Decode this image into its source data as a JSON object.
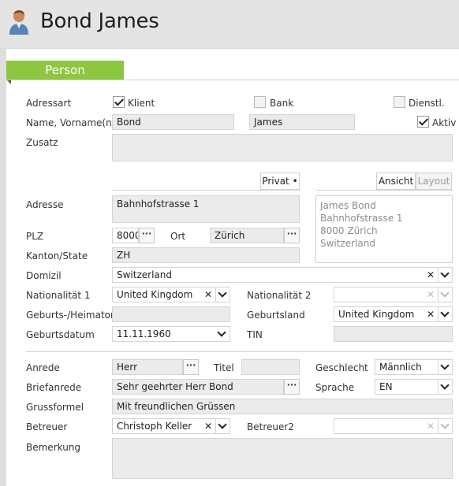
{
  "header": {
    "title": "Bond James",
    "icon": "person-icon"
  },
  "section": {
    "title": "Person"
  },
  "labels": {
    "adressart": "Adressart",
    "name": "Name, Vorname(n)",
    "zusatz": "Zusatz",
    "adresse": "Adresse",
    "plz": "PLZ",
    "ort": "Ort",
    "kanton": "Kanton/State",
    "domizil": "Domizil",
    "nationalitaet1": "Nationalität 1",
    "nationalitaet2": "Nationalität 2",
    "geburtsort": "Geburts-/Heimatort",
    "geburtsland": "Geburtsland",
    "geburtsdatum": "Geburtsdatum",
    "tin": "TIN",
    "anrede": "Anrede",
    "titel": "Titel",
    "geschlecht": "Geschlecht",
    "briefanrede": "Briefanrede",
    "sprache": "Sprache",
    "grussformel": "Grussformel",
    "betreuer": "Betreuer",
    "betreuer2": "Betreuer2",
    "bemerkung": "Bemerkung"
  },
  "checkboxes": {
    "klient": {
      "label": "Klient",
      "checked": true
    },
    "bank": {
      "label": "Bank",
      "checked": false
    },
    "dienstl": {
      "label": "Dienstl.",
      "checked": false
    },
    "aktiv": {
      "label": "Aktiv",
      "checked": true
    }
  },
  "values": {
    "name": "Bond",
    "vorname": "James",
    "zusatz": "",
    "adresse": "Bahnhofstrasse 1",
    "plz": "8000",
    "ort": "Zürich",
    "kanton": "ZH",
    "domizil": "Switzerland",
    "nationalitaet1": "United Kingdom",
    "nationalitaet2": "",
    "geburtsort": "",
    "geburtsland": "United Kingdom",
    "geburtsdatum": "11.11.1960",
    "tin": "",
    "anrede": "Herr",
    "titel": "",
    "geschlecht": "Männlich",
    "briefanrede": "Sehr geehrter Herr Bond",
    "sprache": "EN",
    "grussformel": "Mit freundlichen Grüssen",
    "betreuer": "Christoph Keller",
    "betreuer2": "",
    "bemerkung": ""
  },
  "address_tabs": {
    "privat": "Privat •"
  },
  "preview_tabs": {
    "ansicht": "Ansicht",
    "layout": "Layout"
  },
  "address_preview": [
    "James Bond",
    "Bahnhofstrasse 1",
    "8000 Zürich",
    "Switzerland"
  ],
  "buttons": {
    "dots": "···",
    "clear": "✕"
  },
  "colors": {
    "accent": "#8dc63f",
    "header_bg": "#e4e4e4",
    "field_bg": "#ebebeb"
  }
}
